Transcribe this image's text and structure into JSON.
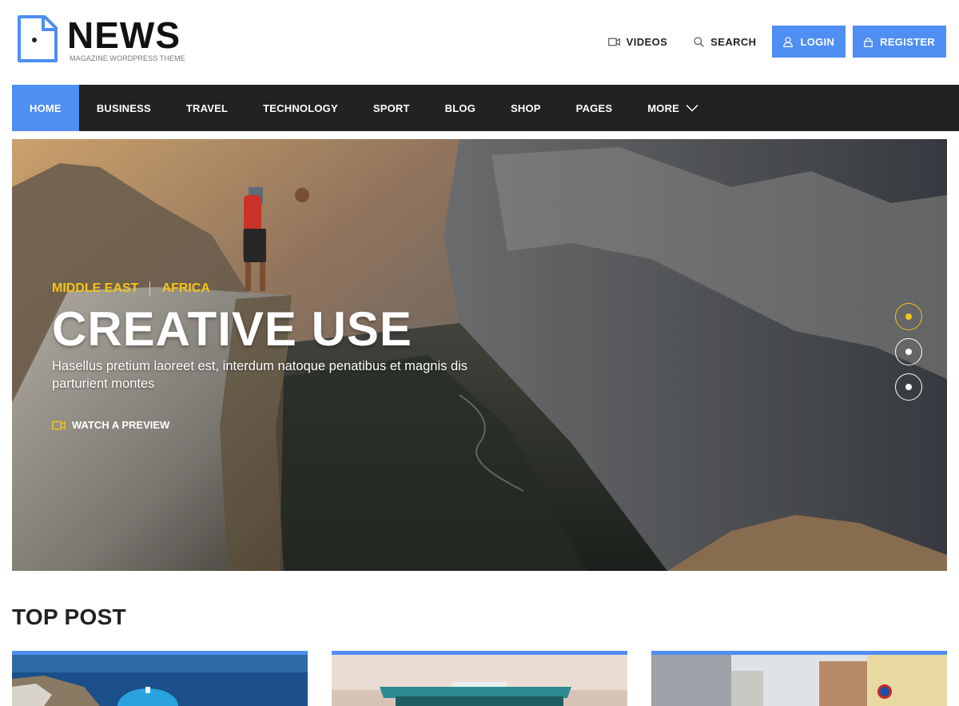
{
  "brand": {
    "title": "NEWS",
    "subtitle": "MAGAZINE WORDPRESS THEME",
    "icon": "document-icon",
    "accent_color": "#4f8ef2"
  },
  "top_actions": {
    "videos_label": "VIDEOS",
    "search_label": "SEARCH",
    "login_label": "LOGIN",
    "register_label": "REGISTER"
  },
  "nav": {
    "items": [
      {
        "label": "HOME",
        "active": true
      },
      {
        "label": "BUSINESS"
      },
      {
        "label": "TRAVEL"
      },
      {
        "label": "TECHNOLOGY"
      },
      {
        "label": "SPORT"
      },
      {
        "label": "BLOG"
      },
      {
        "label": "SHOP"
      },
      {
        "label": "PAGES"
      },
      {
        "label": "MORE"
      }
    ]
  },
  "hero": {
    "category_1": "MIDDLE EAST",
    "category_2": "AFRICA",
    "title": "CREATIVE USE",
    "description": "Hasellus pretium laoreet est, interdum natoque penatibus et magnis dis parturient montes",
    "watch_label": "WATCH A PREVIEW",
    "category_color": "#f5c518",
    "slides_count": 3,
    "active_slide": 1
  },
  "top_post": {
    "heading": "TOP POST"
  }
}
